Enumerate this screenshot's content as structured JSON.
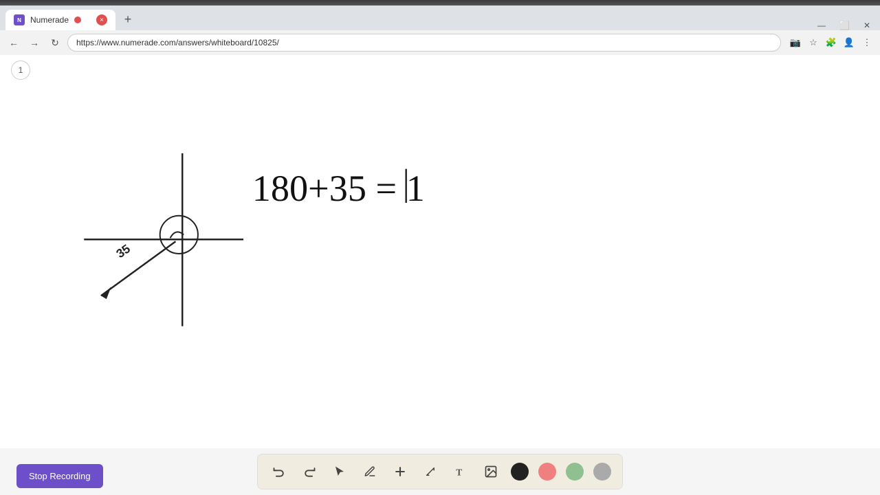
{
  "browser": {
    "title": "Numerade",
    "url": "https://www.numerade.com/answers/whiteboard/10825/",
    "tab_label": "Numerade",
    "new_tab_label": "+",
    "page_number": "1"
  },
  "toolbar": {
    "stop_recording_label": "Stop Recording",
    "tools": [
      {
        "name": "undo",
        "icon": "↩",
        "label": "Undo"
      },
      {
        "name": "redo",
        "icon": "↪",
        "label": "Redo"
      },
      {
        "name": "select",
        "icon": "▶",
        "label": "Select"
      },
      {
        "name": "pen",
        "icon": "✏",
        "label": "Pen"
      },
      {
        "name": "add",
        "icon": "+",
        "label": "Add"
      },
      {
        "name": "highlight",
        "icon": "/",
        "label": "Highlight"
      },
      {
        "name": "text",
        "icon": "T",
        "label": "Text"
      },
      {
        "name": "image",
        "icon": "🖼",
        "label": "Image"
      }
    ],
    "colors": [
      {
        "name": "black",
        "hex": "#222222"
      },
      {
        "name": "pink",
        "hex": "#f08080"
      },
      {
        "name": "green",
        "hex": "#90c090"
      },
      {
        "name": "gray",
        "hex": "#aaaaaa"
      }
    ]
  },
  "drawing": {
    "equation": "180 + 35 = 1"
  }
}
